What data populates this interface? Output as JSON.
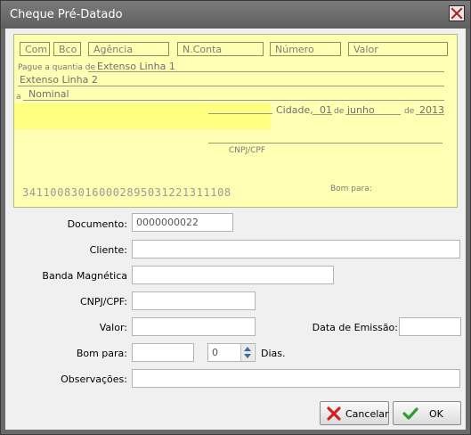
{
  "window": {
    "title": "Cheque Pré-Datado"
  },
  "cheque": {
    "headers": [
      "Com",
      "Bco",
      "Agência",
      "N.Conta",
      "Número",
      "Valor"
    ],
    "pague_label": "Pague a quantia de",
    "extenso_1": "Extenso Linha 1",
    "extenso_2": "Extenso Linha 2",
    "a_label": "a",
    "nominal": "Nominal",
    "cidade": "Cidade,",
    "dia": "01",
    "de1": "de",
    "mes": "junho",
    "de2": "de",
    "ano": "2013",
    "cnpj_cpf": "CNPJ/CPF",
    "barcode": "341100830160002895031221311108",
    "bom_para": "Bom para:"
  },
  "form": {
    "documento_label": "Documento:",
    "documento_value": "0000000022",
    "cliente_label": "Cliente:",
    "cliente_value": "",
    "banda_label": "Banda Magnética",
    "banda_value": "",
    "cnpj_label": "CNPJ/CPF:",
    "cnpj_value": "",
    "valor_label": "Valor:",
    "valor_value": "",
    "emissao_label": "Data de Emissão:",
    "emissao_value": "",
    "bompara_label": "Bom para:",
    "bompara_value": "",
    "dias_value": "0",
    "dias_label": "Dias.",
    "obs_label": "Observações:",
    "obs_value": ""
  },
  "buttons": {
    "cancel": "Cancelar",
    "ok": "OK"
  },
  "icons": {
    "close": "close-icon",
    "cancel": "red-x-icon",
    "ok": "green-check-icon",
    "spin_up": "arrow-up-icon",
    "spin_down": "arrow-down-icon"
  },
  "colors": {
    "cheque_bg": "#ffffb3",
    "highlight": "#ffff80",
    "ok_check": "#2e9d2e",
    "cancel_x": "#d32020"
  }
}
